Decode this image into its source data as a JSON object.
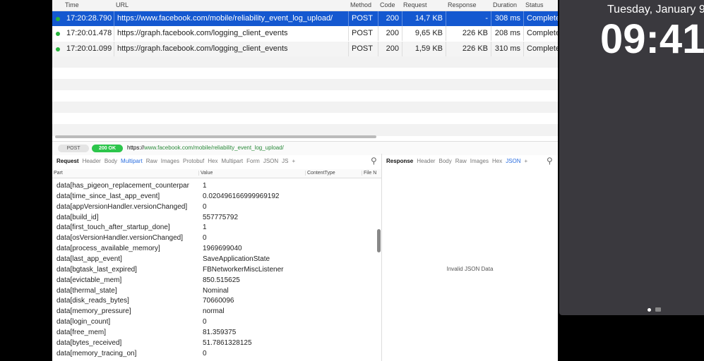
{
  "table": {
    "headers": [
      "Time",
      "URL",
      "Method",
      "Code",
      "Request",
      "Response",
      "Duration",
      "Status"
    ],
    "rows": [
      {
        "time": "17:20:28.790",
        "url": "https://www.facebook.com/mobile/reliability_event_log_upload/",
        "method": "POST",
        "code": "200",
        "request": "14,7 KB",
        "response": "-",
        "duration": "308 ms",
        "status": "Completed"
      },
      {
        "time": "17:20:01.478",
        "url": "https://graph.facebook.com/logging_client_events",
        "method": "POST",
        "code": "200",
        "request": "9,65 KB",
        "response": "226 KB",
        "duration": "208 ms",
        "status": "Completed"
      },
      {
        "time": "17:20:01.099",
        "url": "https://graph.facebook.com/logging_client_events",
        "method": "POST",
        "code": "200",
        "request": "1,59 KB",
        "response": "226 KB",
        "duration": "310 ms",
        "status": "Completed"
      }
    ]
  },
  "statusbar": {
    "method": "POST",
    "code": "200 OK",
    "url_prefix": "https://",
    "url_rest": "www.facebook.com/mobile/reliability_event_log_upload/"
  },
  "request_tabs": [
    "Request",
    "Header",
    "Body",
    "Multipart",
    "Raw",
    "Images",
    "Protobuf",
    "Hex",
    "Multipart",
    "Form",
    "JSON",
    "JS",
    "+"
  ],
  "response_tabs": [
    "Response",
    "Header",
    "Body",
    "Raw",
    "Images",
    "Hex",
    "JSON",
    "+"
  ],
  "columns": [
    "Part",
    "Value",
    "ContentType",
    "File N"
  ],
  "parts": [
    [
      "data[has_pigeon_replacement_counterpar",
      "1"
    ],
    [
      "data[time_since_last_app_event]",
      "0.020496166999969192"
    ],
    [
      "data[appVersionHandler.versionChanged]",
      "0"
    ],
    [
      "data[build_id]",
      "557775792"
    ],
    [
      "data[first_touch_after_startup_done]",
      "1"
    ],
    [
      "data[osVersionHandler.versionChanged]",
      "0"
    ],
    [
      "data[process_available_memory]",
      "1969699040"
    ],
    [
      "data[last_app_event]",
      "SaveApplicationState"
    ],
    [
      "data[bgtask_last_expired]",
      "FBNetworkerMiscListener"
    ],
    [
      "data[evictable_mem]",
      "850.515625"
    ],
    [
      "data[thermal_state]",
      "Nominal"
    ],
    [
      "data[disk_reads_bytes]",
      "70660096"
    ],
    [
      "data[memory_pressure]",
      "normal"
    ],
    [
      "data[login_count]",
      "0"
    ],
    [
      "data[free_mem]",
      "81.359375"
    ],
    [
      "data[bytes_received]",
      "51.7861328125"
    ],
    [
      "data[memory_tracing_on]",
      "0"
    ]
  ],
  "response_body": "Invalid JSON Data",
  "phone": {
    "date": "Tuesday, January 9",
    "time": "09:41"
  }
}
